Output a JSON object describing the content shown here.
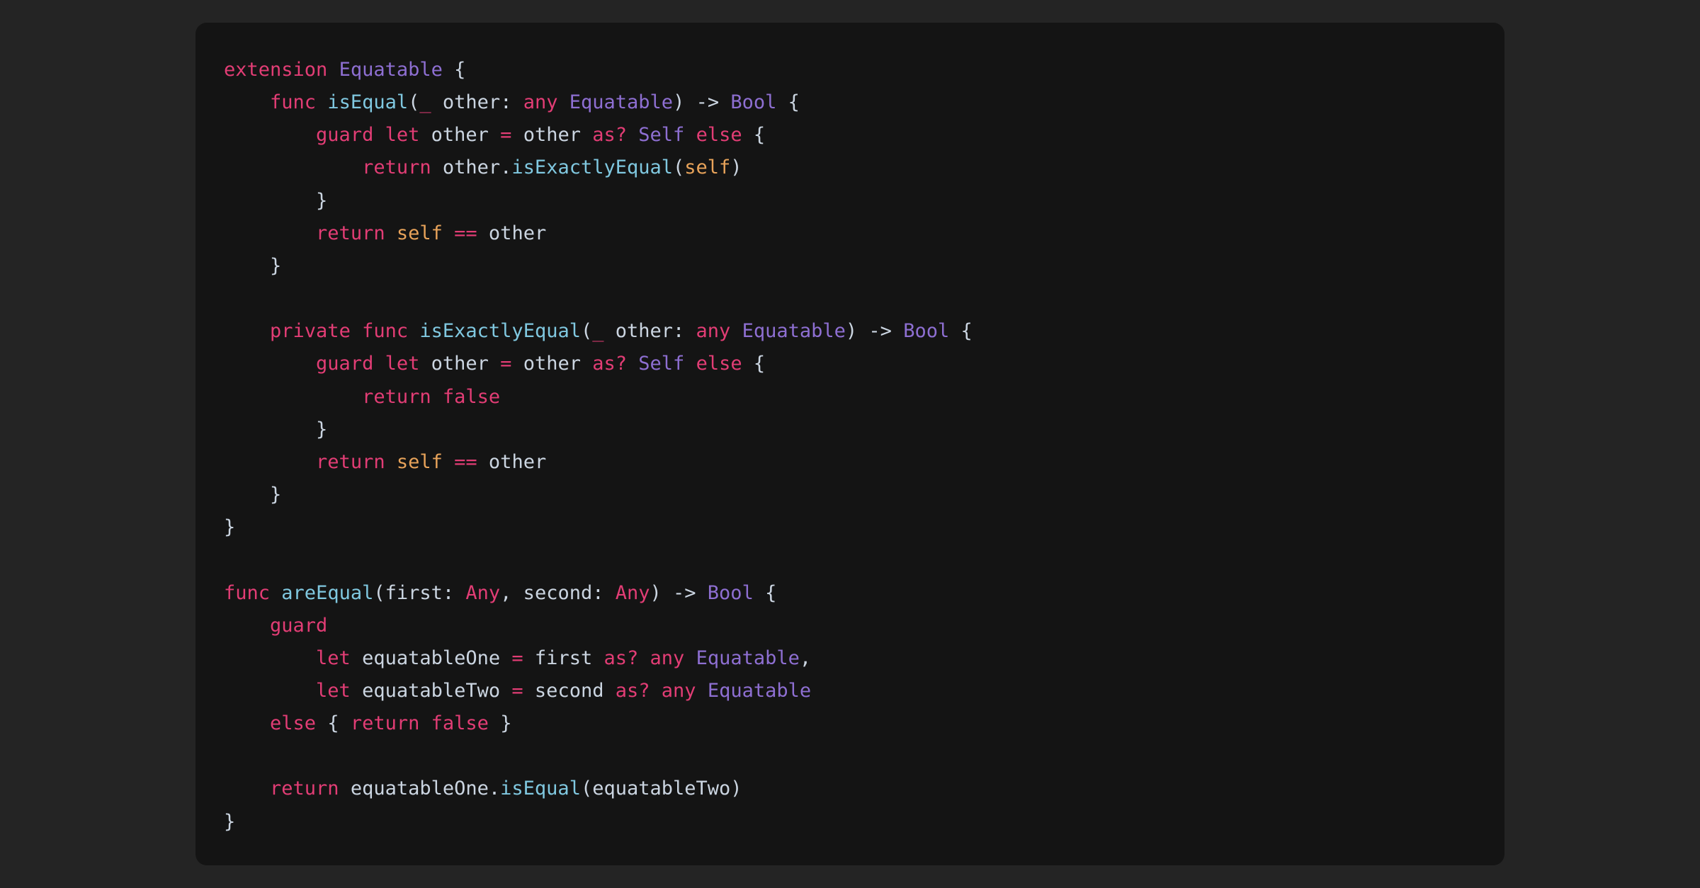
{
  "language": "swift",
  "colors": {
    "page_bg": "#242424",
    "block_bg": "#141414",
    "default": "#cbd5e1",
    "keyword": "#e23d75",
    "type": "#8e6fd2",
    "fn": "#80c8e0",
    "self": "#e8a35a"
  },
  "code": {
    "lines": [
      [
        [
          "keyword",
          "extension"
        ],
        [
          "default",
          " "
        ],
        [
          "type",
          "Equatable"
        ],
        [
          "default",
          " {"
        ]
      ],
      [
        [
          "default",
          "    "
        ],
        [
          "keyword",
          "func"
        ],
        [
          "default",
          " "
        ],
        [
          "fn",
          "isEqual"
        ],
        [
          "default",
          "("
        ],
        [
          "keyword",
          "_"
        ],
        [
          "default",
          " other: "
        ],
        [
          "keyword",
          "any"
        ],
        [
          "default",
          " "
        ],
        [
          "type",
          "Equatable"
        ],
        [
          "default",
          ") -> "
        ],
        [
          "type",
          "Bool"
        ],
        [
          "default",
          " {"
        ]
      ],
      [
        [
          "default",
          "        "
        ],
        [
          "keyword",
          "guard"
        ],
        [
          "default",
          " "
        ],
        [
          "keyword",
          "let"
        ],
        [
          "default",
          " other "
        ],
        [
          "keyword",
          "="
        ],
        [
          "default",
          " other "
        ],
        [
          "keyword",
          "as?"
        ],
        [
          "default",
          " "
        ],
        [
          "type",
          "Self"
        ],
        [
          "default",
          " "
        ],
        [
          "keyword",
          "else"
        ],
        [
          "default",
          " {"
        ]
      ],
      [
        [
          "default",
          "            "
        ],
        [
          "keyword",
          "return"
        ],
        [
          "default",
          " other."
        ],
        [
          "fn",
          "isExactlyEqual"
        ],
        [
          "default",
          "("
        ],
        [
          "self",
          "self"
        ],
        [
          "default",
          ")"
        ]
      ],
      [
        [
          "default",
          "        }"
        ]
      ],
      [
        [
          "default",
          "        "
        ],
        [
          "keyword",
          "return"
        ],
        [
          "default",
          " "
        ],
        [
          "self",
          "self"
        ],
        [
          "default",
          " "
        ],
        [
          "keyword",
          "=="
        ],
        [
          "default",
          " other"
        ]
      ],
      [
        [
          "default",
          "    }"
        ]
      ],
      [
        [
          "default",
          ""
        ]
      ],
      [
        [
          "default",
          "    "
        ],
        [
          "keyword",
          "private"
        ],
        [
          "default",
          " "
        ],
        [
          "keyword",
          "func"
        ],
        [
          "default",
          " "
        ],
        [
          "fn",
          "isExactlyEqual"
        ],
        [
          "default",
          "("
        ],
        [
          "keyword",
          "_"
        ],
        [
          "default",
          " other: "
        ],
        [
          "keyword",
          "any"
        ],
        [
          "default",
          " "
        ],
        [
          "type",
          "Equatable"
        ],
        [
          "default",
          ") -> "
        ],
        [
          "type",
          "Bool"
        ],
        [
          "default",
          " {"
        ]
      ],
      [
        [
          "default",
          "        "
        ],
        [
          "keyword",
          "guard"
        ],
        [
          "default",
          " "
        ],
        [
          "keyword",
          "let"
        ],
        [
          "default",
          " other "
        ],
        [
          "keyword",
          "="
        ],
        [
          "default",
          " other "
        ],
        [
          "keyword",
          "as?"
        ],
        [
          "default",
          " "
        ],
        [
          "type",
          "Self"
        ],
        [
          "default",
          " "
        ],
        [
          "keyword",
          "else"
        ],
        [
          "default",
          " {"
        ]
      ],
      [
        [
          "default",
          "            "
        ],
        [
          "keyword",
          "return"
        ],
        [
          "default",
          " "
        ],
        [
          "keyword",
          "false"
        ]
      ],
      [
        [
          "default",
          "        }"
        ]
      ],
      [
        [
          "default",
          "        "
        ],
        [
          "keyword",
          "return"
        ],
        [
          "default",
          " "
        ],
        [
          "self",
          "self"
        ],
        [
          "default",
          " "
        ],
        [
          "keyword",
          "=="
        ],
        [
          "default",
          " other"
        ]
      ],
      [
        [
          "default",
          "    }"
        ]
      ],
      [
        [
          "default",
          "}"
        ]
      ],
      [
        [
          "default",
          ""
        ]
      ],
      [
        [
          "keyword",
          "func"
        ],
        [
          "default",
          " "
        ],
        [
          "fn",
          "areEqual"
        ],
        [
          "default",
          "(first: "
        ],
        [
          "keyword",
          "Any"
        ],
        [
          "default",
          ", second: "
        ],
        [
          "keyword",
          "Any"
        ],
        [
          "default",
          ") -> "
        ],
        [
          "type",
          "Bool"
        ],
        [
          "default",
          " {"
        ]
      ],
      [
        [
          "default",
          "    "
        ],
        [
          "keyword",
          "guard"
        ]
      ],
      [
        [
          "default",
          "        "
        ],
        [
          "keyword",
          "let"
        ],
        [
          "default",
          " equatableOne "
        ],
        [
          "keyword",
          "="
        ],
        [
          "default",
          " first "
        ],
        [
          "keyword",
          "as?"
        ],
        [
          "default",
          " "
        ],
        [
          "keyword",
          "any"
        ],
        [
          "default",
          " "
        ],
        [
          "type",
          "Equatable"
        ],
        [
          "default",
          ","
        ]
      ],
      [
        [
          "default",
          "        "
        ],
        [
          "keyword",
          "let"
        ],
        [
          "default",
          " equatableTwo "
        ],
        [
          "keyword",
          "="
        ],
        [
          "default",
          " second "
        ],
        [
          "keyword",
          "as?"
        ],
        [
          "default",
          " "
        ],
        [
          "keyword",
          "any"
        ],
        [
          "default",
          " "
        ],
        [
          "type",
          "Equatable"
        ]
      ],
      [
        [
          "default",
          "    "
        ],
        [
          "keyword",
          "else"
        ],
        [
          "default",
          " { "
        ],
        [
          "keyword",
          "return"
        ],
        [
          "default",
          " "
        ],
        [
          "keyword",
          "false"
        ],
        [
          "default",
          " }"
        ]
      ],
      [
        [
          "default",
          ""
        ]
      ],
      [
        [
          "default",
          "    "
        ],
        [
          "keyword",
          "return"
        ],
        [
          "default",
          " equatableOne."
        ],
        [
          "fn",
          "isEqual"
        ],
        [
          "default",
          "(equatableTwo)"
        ]
      ],
      [
        [
          "default",
          "}"
        ]
      ]
    ]
  }
}
